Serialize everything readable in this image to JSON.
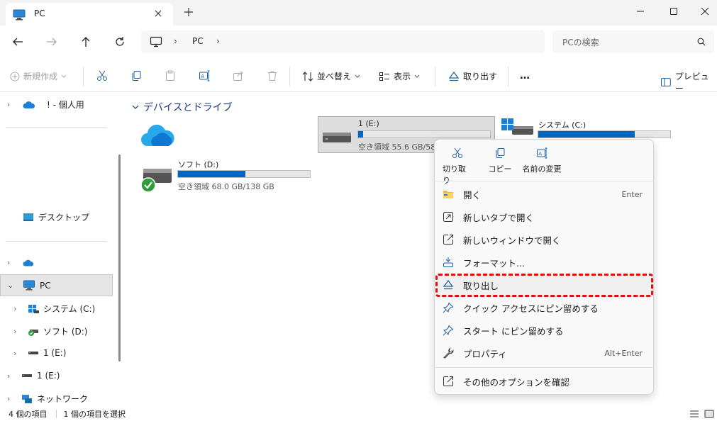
{
  "window": {
    "tab_title": "PC",
    "new_tab_glyph": "+",
    "tab_close_glyph": "×"
  },
  "address": {
    "crumb": "PC",
    "sep": "›",
    "search_placeholder": "PCの検索"
  },
  "toolbar": {
    "new_label": "新規作成",
    "sort_label": "並べ替え",
    "view_label": "表示",
    "eject_label": "取り出す",
    "more_label": "…",
    "preview_label": "プレビュー"
  },
  "sidebar": {
    "onedrive_personal": "! - 個人用",
    "desktop": "デスクトップ",
    "pc": "PC",
    "system_c": "システム (C:)",
    "soft_d": "ソフト (D:)",
    "usb_e_child": "1 (E:)",
    "usb_e": "1 (E:)",
    "network": "ネットワーク"
  },
  "main": {
    "section_title": "デバイスとドライブ",
    "drives": {
      "e": {
        "name": "1 (E:)",
        "free": "空き領域 55.6 GB/58",
        "used_fraction": 0.04
      },
      "c": {
        "name": "システム (C:)",
        "used_fraction": 0.73
      },
      "d": {
        "name": "ソフト (D:)",
        "free": "空き領域 68.0 GB/138 GB",
        "used_fraction": 0.51
      }
    }
  },
  "context_menu": {
    "top": {
      "cut": "切り取り",
      "copy": "コピー",
      "rename": "名前の変更"
    },
    "items": {
      "open": "開く",
      "open_shortcut": "Enter",
      "open_new_tab": "新しいタブで開く",
      "open_new_window": "新しいウィンドウで開く",
      "format": "フォーマット...",
      "eject": "取り出し",
      "pin_quick": "クイック アクセスにピン留めする",
      "pin_start": "スタート にピン留めする",
      "properties": "プロパティ",
      "properties_shortcut": "Alt+Enter",
      "more_options": "その他のオプションを確認"
    }
  },
  "status": {
    "item_count": "4 個の項目",
    "selected": "1 個の項目を選択"
  },
  "colors": {
    "accent": "#0067c0",
    "highlight": "#dd1111"
  }
}
